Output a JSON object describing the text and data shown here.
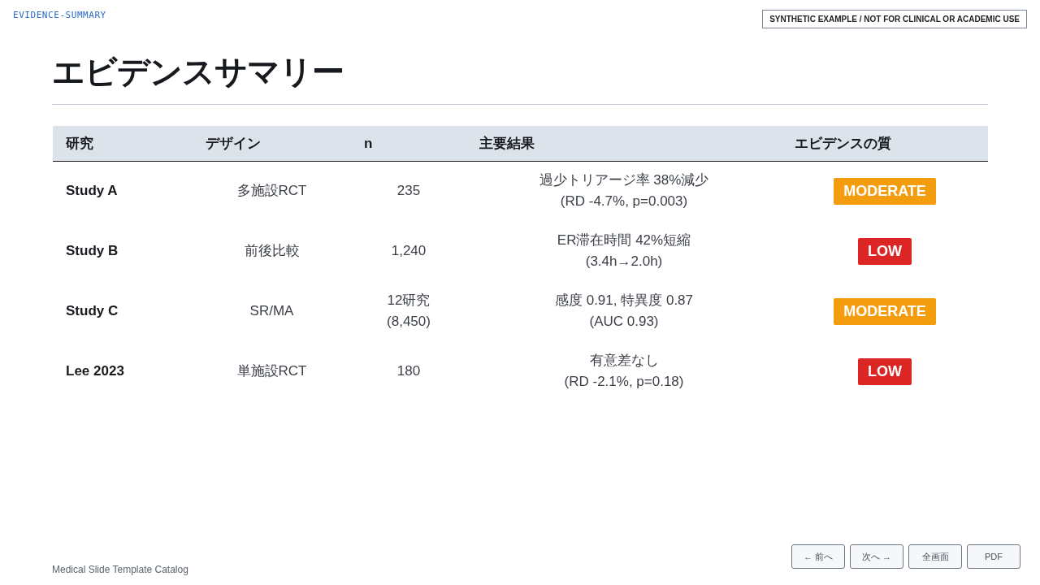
{
  "slide_id": "EVIDENCE-SUMMARY",
  "disclaimer": "SYNTHETIC EXAMPLE / NOT FOR CLINICAL OR ACADEMIC USE",
  "title": "エビデンスサマリー",
  "table": {
    "columns": [
      "研究",
      "デザイン",
      "n",
      "主要結果",
      "エビデンスの質"
    ],
    "rows": [
      {
        "study": "Study A",
        "design": "多施設RCT",
        "n": [
          "235"
        ],
        "result": [
          "過少トリアージ率 38%減少",
          "(RD -4.7%, p=0.003)"
        ],
        "quality": {
          "label": "MODERATE",
          "color": "#f39c0e"
        }
      },
      {
        "study": "Study B",
        "design": "前後比較",
        "n": [
          "1,240"
        ],
        "result": [
          "ER滞在時間 42%短縮",
          "(3.4h→2.0h)"
        ],
        "quality": {
          "label": "LOW",
          "color": "#dc2626"
        }
      },
      {
        "study": "Study C",
        "design": "SR/MA",
        "n": [
          "12研究",
          "(8,450)"
        ],
        "result": [
          "感度 0.91, 特異度 0.87",
          "(AUC 0.93)"
        ],
        "quality": {
          "label": "MODERATE",
          "color": "#f39c0e"
        }
      },
      {
        "study": "Lee 2023",
        "design": "単施設RCT",
        "n": [
          "180"
        ],
        "result": [
          "有意差なし",
          "(RD -2.1%, p=0.18)"
        ],
        "quality": {
          "label": "LOW",
          "color": "#dc2626"
        }
      }
    ]
  },
  "footer": "Medical Slide Template Catalog",
  "nav_buttons": [
    "← 前へ",
    "次へ →",
    "全画面",
    "PDF"
  ]
}
